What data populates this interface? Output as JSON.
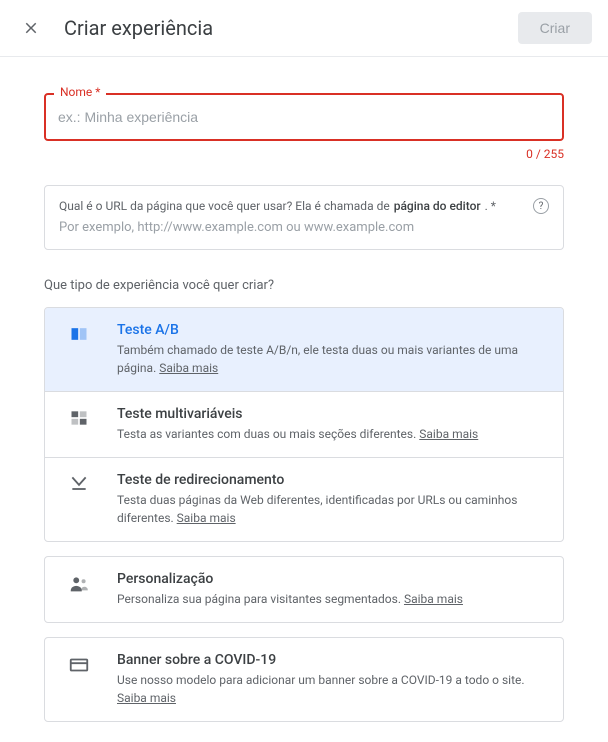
{
  "header": {
    "title": "Criar experiência",
    "create_button": "Criar"
  },
  "name_field": {
    "label": "Nome *",
    "placeholder": "ex.: Minha experiência",
    "value": "",
    "counter": "0 / 255"
  },
  "url_field": {
    "question_prefix": "Qual é o URL da página que você quer usar? Ela é chamada de",
    "question_bold": "página do editor",
    "question_suffix": ". *",
    "example": "Por exemplo, http://www.example.com ou www.example.com"
  },
  "type_section": {
    "title": "Que tipo de experiência você quer criar?"
  },
  "options": {
    "ab": {
      "title": "Teste A/B",
      "desc": "Também chamado de teste A/B/n, ele testa duas ou mais variantes de uma página.",
      "learn": "Saiba mais"
    },
    "mvt": {
      "title": "Teste multivariáveis",
      "desc": "Testa as variantes com duas ou mais seções diferentes.",
      "learn": "Saiba mais"
    },
    "redirect": {
      "title": "Teste de redirecionamento",
      "desc": "Testa duas páginas da Web diferentes, identificadas por URLs ou caminhos diferentes.",
      "learn": "Saiba mais"
    },
    "personalization": {
      "title": "Personalização",
      "desc": "Personaliza sua página para visitantes segmentados.",
      "learn": "Saiba mais"
    },
    "banner": {
      "title": "Banner sobre a COVID-19",
      "desc": "Use nosso modelo para adicionar um banner sobre a COVID-19 a todo o site.",
      "learn": "Saiba mais"
    }
  }
}
